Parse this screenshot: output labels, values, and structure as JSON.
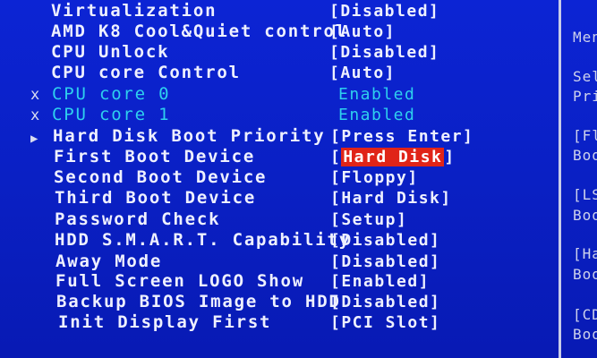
{
  "settings": [
    {
      "label": "Virtualization",
      "value": "[Disabled]",
      "state": "normal",
      "marker": ""
    },
    {
      "label": "AMD K8 Cool&Quiet control",
      "value": "[Auto]",
      "state": "normal",
      "marker": ""
    },
    {
      "label": "CPU Unlock",
      "value": "[Disabled]",
      "state": "normal",
      "marker": ""
    },
    {
      "label": "CPU core Control",
      "value": "[Auto]",
      "state": "normal",
      "marker": ""
    },
    {
      "label": "CPU core 0",
      "value": "Enabled",
      "state": "disabled",
      "marker": "x"
    },
    {
      "label": "CPU core 1",
      "value": "Enabled",
      "state": "disabled",
      "marker": "x"
    },
    {
      "label": "Hard Disk Boot Priority",
      "value": "[Press Enter]",
      "state": "normal",
      "marker": "▶"
    },
    {
      "label": "First Boot Device",
      "value_open": "[",
      "value": "Hard Disk",
      "value_close": "]",
      "state": "selected",
      "marker": ""
    },
    {
      "label": "Second Boot Device",
      "value": "[Floppy]",
      "state": "normal",
      "marker": ""
    },
    {
      "label": "Third Boot Device",
      "value": "[Hard Disk]",
      "state": "normal",
      "marker": ""
    },
    {
      "label": "Password Check",
      "value": "[Setup]",
      "state": "normal",
      "marker": ""
    },
    {
      "label": "HDD S.M.A.R.T. Capability",
      "value": "[Disabled]",
      "state": "normal",
      "marker": ""
    },
    {
      "label": "Away Mode",
      "value": "[Disabled]",
      "state": "normal",
      "marker": ""
    },
    {
      "label": "Full Screen LOGO Show",
      "value": "[Enabled]",
      "state": "normal",
      "marker": ""
    },
    {
      "label": "Backup BIOS Image to HDD",
      "value": "[Disabled]",
      "state": "normal",
      "marker": ""
    },
    {
      "label": "Init Display First",
      "value": "[PCI Slot]",
      "state": "normal",
      "marker": ""
    }
  ],
  "help_panel": [
    "Men",
    "Sel",
    "Pri",
    "[Fl",
    "Boo",
    "[LS",
    "Boo",
    "[Ha",
    "Boo",
    "[CD",
    "Boo"
  ],
  "colors": {
    "background": "#0a1fc8",
    "text": "#eef0ff",
    "disabled_text": "#2ed0ee",
    "highlight": "#e02418"
  }
}
